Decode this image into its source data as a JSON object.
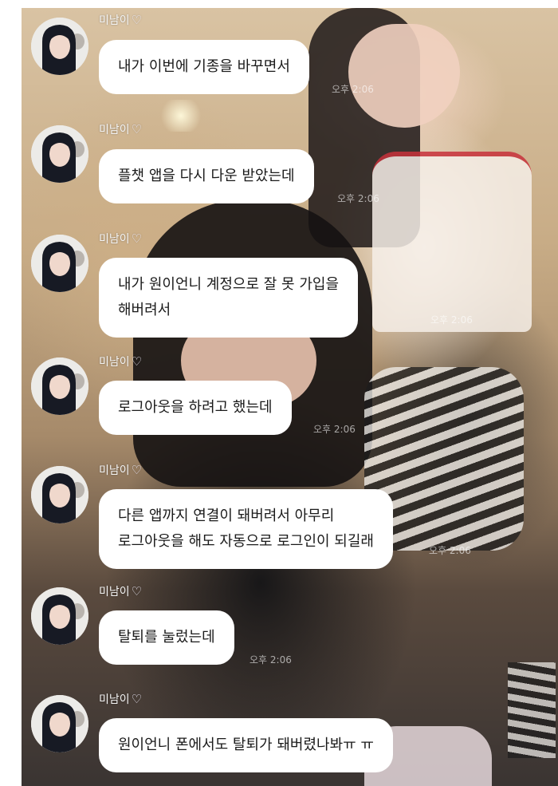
{
  "messages": [
    {
      "sender": "미남이",
      "text_lines": [
        "내가 이번에 기종을 바꾸면서"
      ],
      "time": "오후 2:06"
    },
    {
      "sender": "미남이",
      "text_lines": [
        "플챗 앱을 다시 다운 받았는데"
      ],
      "time": "오후 2:06"
    },
    {
      "sender": "미남이",
      "text_lines": [
        "내가 원이언니 계정으로 잘 못 가입을",
        "해버려서"
      ],
      "time": "오후 2:06"
    },
    {
      "sender": "미남이",
      "text_lines": [
        "로그아웃을 하려고 했는데"
      ],
      "time": "오후 2:06"
    },
    {
      "sender": "미남이",
      "text_lines": [
        "다른 앱까지 연결이 돼버려서 아무리",
        "로그아웃을 해도 자동으로 로그인이 되길래"
      ],
      "time": "오후 2:06"
    },
    {
      "sender": "미남이",
      "text_lines": [
        "탈퇴를 눌렀는데"
      ],
      "time": "오후 2:06"
    },
    {
      "sender": "미남이",
      "text_lines": [
        "원이언니 폰에서도 탈퇴가 돼버렸나봐ㅠ ㅠ"
      ],
      "time": ""
    }
  ],
  "colors": {
    "bubble": "#ffffff",
    "text": "#1a1a1a",
    "sender_name": "#f4f4f4"
  },
  "icons": {
    "heart": "white-heart-icon",
    "avatar": "profile-avatar"
  }
}
